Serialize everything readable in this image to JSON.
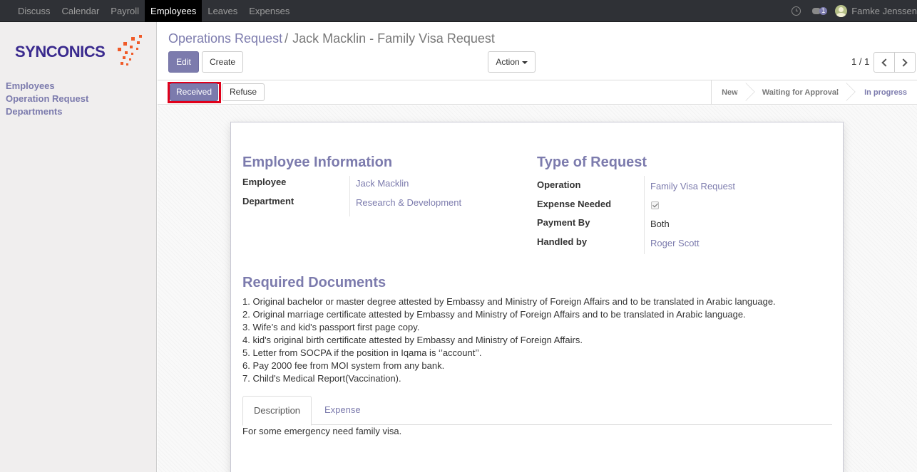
{
  "topbar": {
    "menu": [
      "Discuss",
      "Calendar",
      "Payroll",
      "Employees",
      "Leaves",
      "Expenses"
    ],
    "active_menu": "Employees",
    "chat_count": "1",
    "user_name": "Famke Jenssen"
  },
  "sidebar": {
    "logo_text": "SYNCONICS",
    "links": [
      "Employees",
      "Operation Request",
      "Departments"
    ]
  },
  "control_panel": {
    "breadcrumb_parent": "Operations Request",
    "breadcrumb_separator": "/",
    "breadcrumb_current": "Jack Macklin - Family Visa Request",
    "edit_label": "Edit",
    "create_label": "Create",
    "action_label": "Action",
    "pager": "1 / 1"
  },
  "statusbar": {
    "received_label": "Received",
    "refuse_label": "Refuse",
    "stages": [
      "New",
      "Waiting for Approval",
      "In progress"
    ],
    "active_stage": "In progress"
  },
  "form": {
    "employee_section": {
      "title": "Employee Information",
      "employee_label": "Employee",
      "employee_value": "Jack Macklin",
      "department_label": "Department",
      "department_value": "Research & Development"
    },
    "request_section": {
      "title": "Type of Request",
      "operation_label": "Operation",
      "operation_value": "Family Visa Request",
      "expense_needed_label": "Expense Needed",
      "expense_needed_checked": true,
      "payment_by_label": "Payment By",
      "payment_by_value": "Both",
      "handled_by_label": "Handled by",
      "handled_by_value": "Roger Scott"
    },
    "documents": {
      "title": "Required Documents",
      "items": [
        "1. Original bachelor or master degree attested by Embassy and Ministry of Foreign Affairs and to be translated in Arabic language.",
        "2. Original marriage certificate attested by Embassy and Ministry of Foreign Affairs and to be translated in Arabic language.",
        "3. Wife’s and kid's passport first page copy.",
        "4. kid's original birth certificate attested by Embassy and Ministry of Foreign Affairs.",
        "5. Letter from SOCPA if the position in Iqama is ‘’account’’.",
        "6. Pay 2000 fee from MOI system from any bank.",
        "7. Child's Medical Report(Vaccination)."
      ]
    },
    "tabs": {
      "description_label": "Description",
      "expense_label": "Expense",
      "active": "Description",
      "description_text": "For some emergency need family visa."
    }
  },
  "colors": {
    "accent": "#7c7bad",
    "topbar": "#2f3136",
    "highlight": "#e0001b",
    "logo_blue": "#3a2a8e",
    "logo_orange": "#f05a28"
  }
}
